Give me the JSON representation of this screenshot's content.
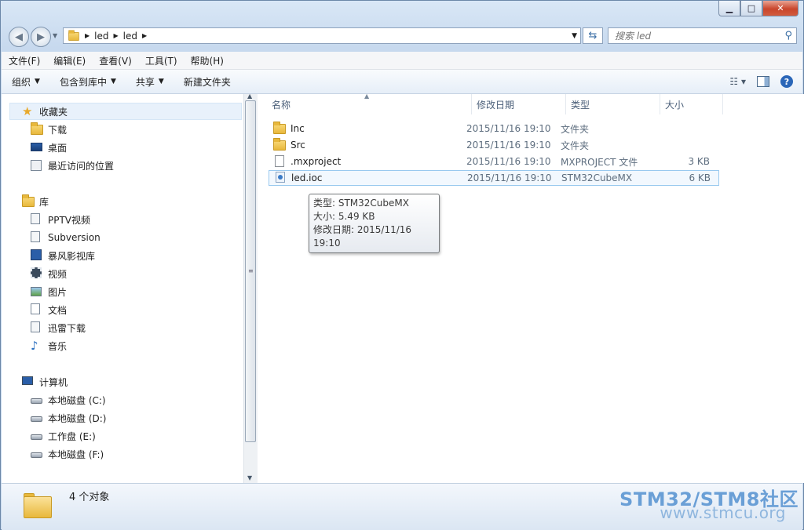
{
  "window": {
    "min_label": "▁",
    "max_label": "□",
    "close_label": "✕"
  },
  "address": {
    "crumbs": [
      "led",
      "led"
    ]
  },
  "search": {
    "placeholder": "搜索 led"
  },
  "menu": [
    "文件(F)",
    "编辑(E)",
    "查看(V)",
    "工具(T)",
    "帮助(H)"
  ],
  "toolbar": {
    "organize": "组织",
    "include": "包含到库中",
    "share": "共享",
    "new_folder": "新建文件夹"
  },
  "nav": {
    "favorites": {
      "label": "收藏夹",
      "items": [
        "下载",
        "桌面",
        "最近访问的位置"
      ]
    },
    "libraries": {
      "label": "库",
      "items": [
        "PPTV视频",
        "Subversion",
        "暴风影视库",
        "视频",
        "图片",
        "文档",
        "迅雷下载",
        "音乐"
      ]
    },
    "computer": {
      "label": "计算机",
      "items": [
        "本地磁盘 (C:)",
        "本地磁盘 (D:)",
        "工作盘 (E:)",
        "本地磁盘 (F:)"
      ]
    }
  },
  "columns": {
    "name": "名称",
    "date": "修改日期",
    "type": "类型",
    "size": "大小"
  },
  "files": [
    {
      "name": "Inc",
      "date": "2015/11/16 19:10",
      "type": "文件夹",
      "size": "",
      "icon": "folder-icon"
    },
    {
      "name": "Src",
      "date": "2015/11/16 19:10",
      "type": "文件夹",
      "size": "",
      "icon": "folder-icon"
    },
    {
      "name": ".mxproject",
      "date": "2015/11/16 19:10",
      "type": "MXPROJECT 文件",
      "size": "3 KB",
      "icon": "document-icon"
    },
    {
      "name": "led.ioc",
      "date": "2015/11/16 19:10",
      "type": "STM32CubeMX",
      "size": "6 KB",
      "icon": "stm32cubemx-file-icon"
    }
  ],
  "tooltip": {
    "line1": "类型: STM32CubeMX",
    "line2": "大小: 5.49 KB",
    "line3": "修改日期: 2015/11/16 19:10"
  },
  "status": {
    "count": "4 个对象"
  },
  "watermark": {
    "line1": "STM32/STM8社区",
    "line2": "www.stmcu.org"
  }
}
